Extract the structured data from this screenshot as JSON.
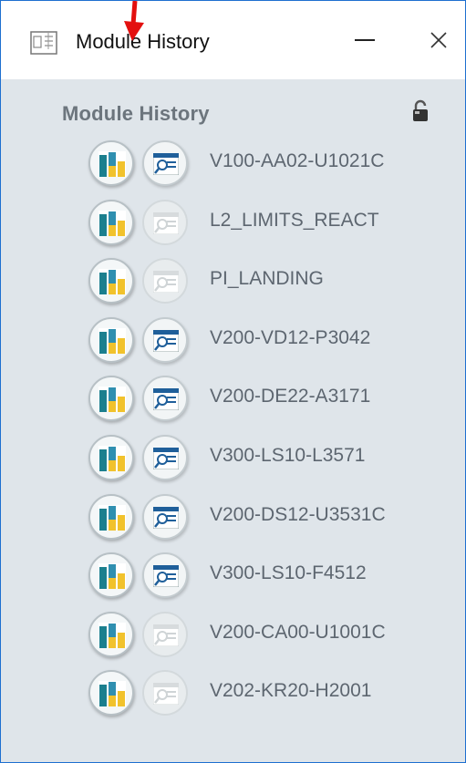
{
  "window": {
    "title": "Module History",
    "minimize_icon": "minimize-icon",
    "close_icon": "close-icon",
    "accent_color": "#1e6fd0"
  },
  "panel": {
    "header": "Module History",
    "lock_icon": "lock-icon"
  },
  "modules": [
    {
      "name": "V100-AA02-U1021C",
      "details_enabled": true
    },
    {
      "name": "L2_LIMITS_REACT",
      "details_enabled": false
    },
    {
      "name": "PI_LANDING",
      "details_enabled": false
    },
    {
      "name": "V200-VD12-P3042",
      "details_enabled": true
    },
    {
      "name": "V200-DE22-A3171",
      "details_enabled": true
    },
    {
      "name": "V300-LS10-L3571",
      "details_enabled": true
    },
    {
      "name": "V200-DS12-U3531C",
      "details_enabled": true
    },
    {
      "name": "V300-LS10-F4512",
      "details_enabled": true
    },
    {
      "name": "V200-CA00-U1001C",
      "details_enabled": false
    },
    {
      "name": "V202-KR20-H2001",
      "details_enabled": false
    }
  ]
}
